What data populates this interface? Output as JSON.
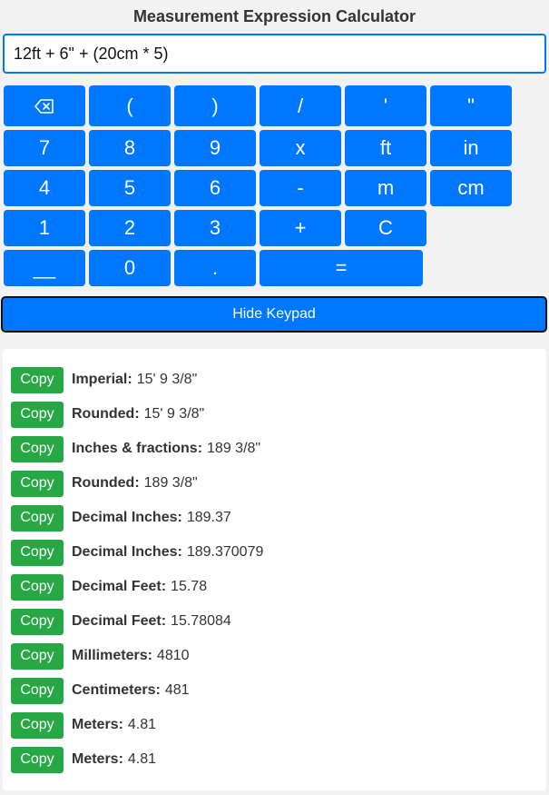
{
  "title": "Measurement Expression Calculator",
  "expression": {
    "value": "12ft + 6\" + (20cm * 5)"
  },
  "keypad": {
    "keys": [
      {
        "label": "",
        "icon": "backspace-icon"
      },
      {
        "label": "("
      },
      {
        "label": ")"
      },
      {
        "label": "/"
      },
      {
        "label": "'"
      },
      {
        "label": "\""
      },
      {
        "label": "7"
      },
      {
        "label": "8"
      },
      {
        "label": "9"
      },
      {
        "label": "x"
      },
      {
        "label": "ft"
      },
      {
        "label": "in"
      },
      {
        "label": "4"
      },
      {
        "label": "5"
      },
      {
        "label": "6"
      },
      {
        "label": "-"
      },
      {
        "label": "m"
      },
      {
        "label": "cm"
      },
      {
        "label": "1"
      },
      {
        "label": "2"
      },
      {
        "label": "3"
      },
      {
        "label": "+"
      },
      {
        "label": "C"
      },
      {
        "label": "__"
      },
      {
        "label": "0"
      },
      {
        "label": "."
      },
      {
        "label": "="
      }
    ]
  },
  "toggle_label": "Hide Keypad",
  "copy_label": "Copy",
  "results": [
    {
      "label": "Imperial:",
      "value": "15' 9 3/8\""
    },
    {
      "label": "Rounded:",
      "value": "15' 9 3/8\""
    },
    {
      "label": "Inches & fractions:",
      "value": "189 3/8\""
    },
    {
      "label": "Rounded:",
      "value": "189 3/8\""
    },
    {
      "label": "Decimal Inches:",
      "value": "189.37"
    },
    {
      "label": "Decimal Inches:",
      "value": "189.370079"
    },
    {
      "label": "Decimal Feet:",
      "value": "15.78"
    },
    {
      "label": "Decimal Feet:",
      "value": "15.78084"
    },
    {
      "label": "Millimeters:",
      "value": "4810"
    },
    {
      "label": "Centimeters:",
      "value": "481"
    },
    {
      "label": "Meters:",
      "value": "4.81"
    },
    {
      "label": "Meters:",
      "value": "4.81"
    }
  ],
  "colors": {
    "key_blue": "#0077ff",
    "copy_green": "#28a745"
  }
}
